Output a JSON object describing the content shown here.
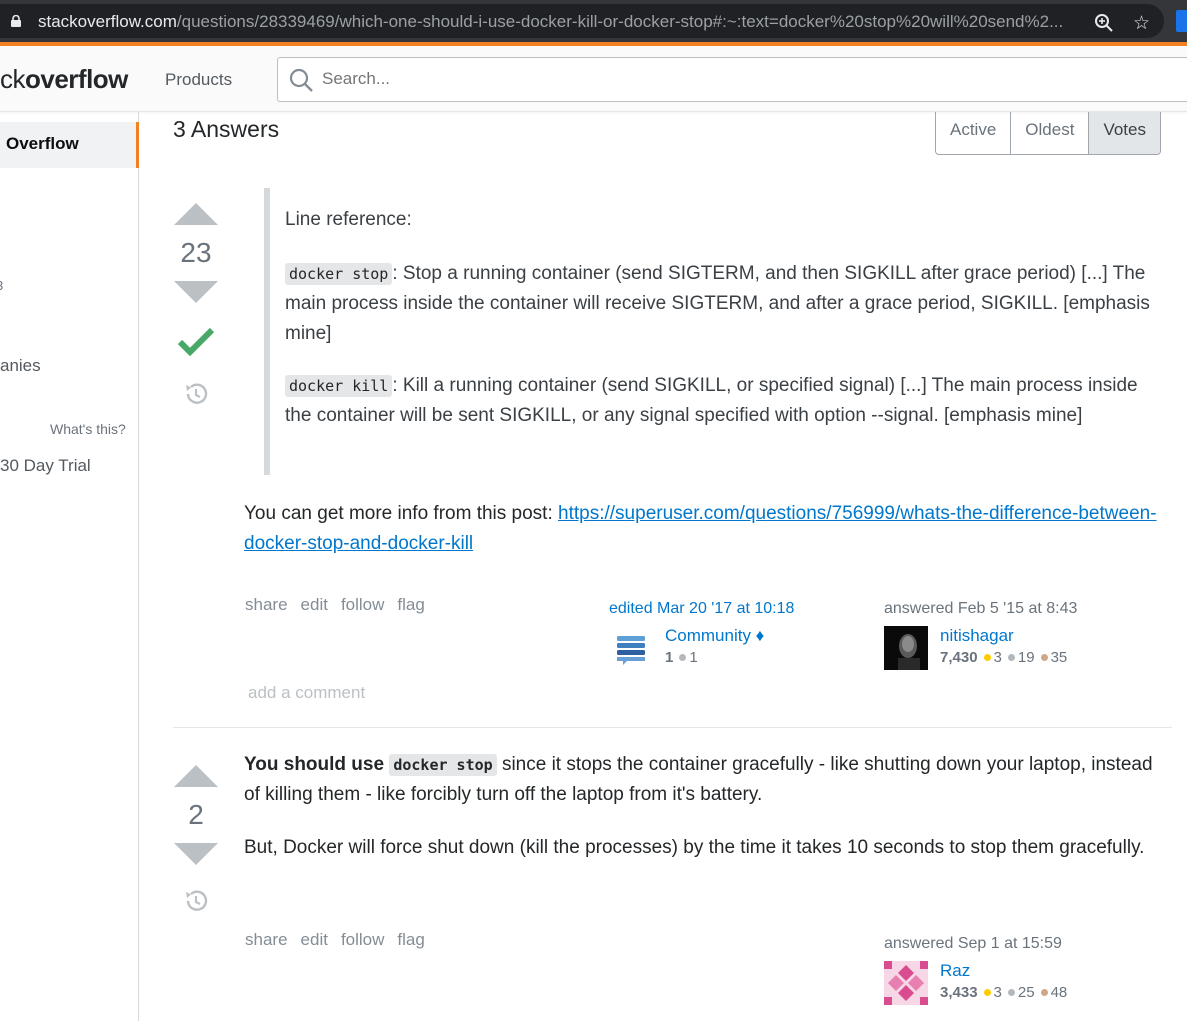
{
  "browser": {
    "url_host": "stackoverflow.com",
    "url_path": "/questions/28339469/which-one-should-i-use-docker-kill-or-docker-stop#:~:text=docker%20stop%20will%20send%2..."
  },
  "topnav": {
    "logo_prefix": "ck",
    "logo_suffix": "overflow",
    "products_label": "Products",
    "search_placeholder": "Search..."
  },
  "sidebar": {
    "overflow_label": "Overflow",
    "b_label": "3",
    "companies_label": "anies",
    "whats_this": "What's this?",
    "trial_label": "30 Day Trial"
  },
  "answers_header": {
    "count_label": "3 Answers",
    "sort_tabs": [
      "Active",
      "Oldest",
      "Votes"
    ]
  },
  "answer1": {
    "votes": "23",
    "accepted": true,
    "quote_intro": "Line reference:",
    "stop_code": "docker stop",
    "stop_text": ": Stop a running container (send SIGTERM, and then SIGKILL after grace period) [...] The main process inside the container will receive SIGTERM, and after a grace period, SIGKILL. [emphasis mine]",
    "kill_code": "docker kill",
    "kill_text": ": Kill a running container (send SIGKILL, or specified signal) [...] The main process inside the container will be sent SIGKILL, or any signal specified with option --signal. [emphasis mine]",
    "more_info": "You can get more info from this post: ",
    "more_link": "https://superuser.com/questions/756999/whats-the-difference-between-docker-stop-and-docker-kill",
    "menu": [
      "share",
      "edit",
      "follow",
      "flag"
    ],
    "edited": "edited Mar 20 '17 at 10:18",
    "editor_name": "Community ♦",
    "editor_rep": "1",
    "editor_silver": "1",
    "answered": "answered Feb 5 '15 at 8:43",
    "author_name": "nitishagar",
    "author_rep": "7,430",
    "author_gold": "3",
    "author_silver": "19",
    "author_bronze": "35",
    "add_comment": "add a comment"
  },
  "answer2": {
    "votes": "2",
    "bold_intro": "You should use ",
    "code": "docker stop",
    "text1": " since it stops the container gracefully - like shutting down your laptop, instead of killing them - like forcibly turn off the laptop from it's battery.",
    "text2": "But, Docker will force shut down (kill the processes) by the time it takes 10 seconds to stop them gracefully.",
    "menu": [
      "share",
      "edit",
      "follow",
      "flag"
    ],
    "answered": "answered Sep 1 at 15:59",
    "author_name": "Raz",
    "author_rep": "3,433",
    "author_gold": "3",
    "author_silver": "25",
    "author_bronze": "48"
  },
  "colors": {
    "accent": "#f48024",
    "link": "#0077cc",
    "accepted": "#48a868",
    "gold": "#ffcc01",
    "silver": "#b4b8bc",
    "bronze": "#d1a684"
  }
}
